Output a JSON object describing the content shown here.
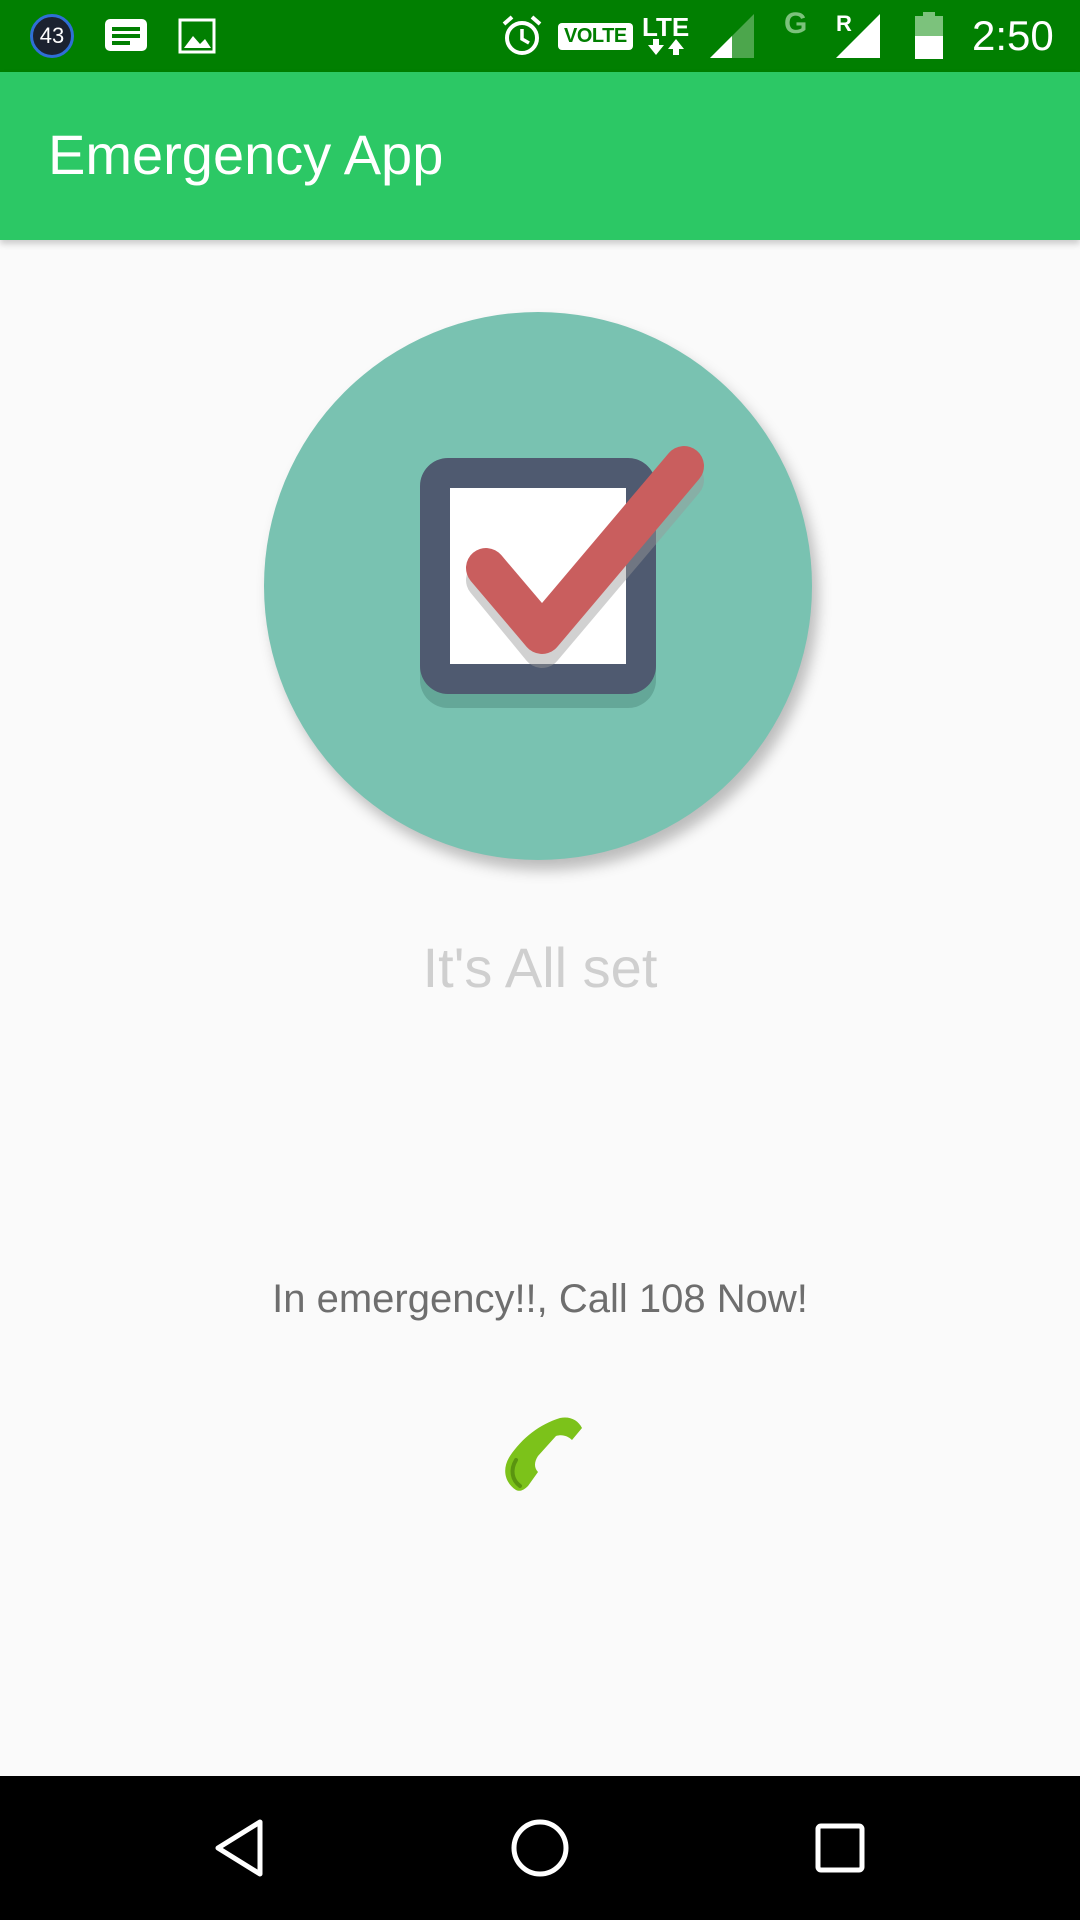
{
  "status_bar": {
    "notification_count": "43",
    "volte": "VOLTE",
    "lte": "LTE",
    "network_g": "G",
    "roaming": "R",
    "time": "2:50",
    "icons": [
      "notification-count-icon",
      "message-icon",
      "image-icon",
      "alarm-icon",
      "volte-icon",
      "lte-icon",
      "signal-icon",
      "signal-roaming-icon",
      "battery-icon"
    ]
  },
  "app_bar": {
    "title": "Emergency App"
  },
  "main": {
    "hero_icon": "checkbox-checked-icon",
    "status_message": "It's All set",
    "emergency_message": "In emergency!!, Call 108 Now!",
    "call_icon": "phone-icon"
  },
  "nav_bar": {
    "buttons": [
      "back-icon",
      "home-icon",
      "recents-icon"
    ]
  },
  "colors": {
    "status_bar": "#017F01",
    "app_bar": "#2CC865",
    "hero_circle": "#79C2B1",
    "checkbox_frame": "#4F5A70",
    "checkmark": "#C95E5E",
    "phone": "#7CC21A",
    "background": "#FAFAFA"
  }
}
